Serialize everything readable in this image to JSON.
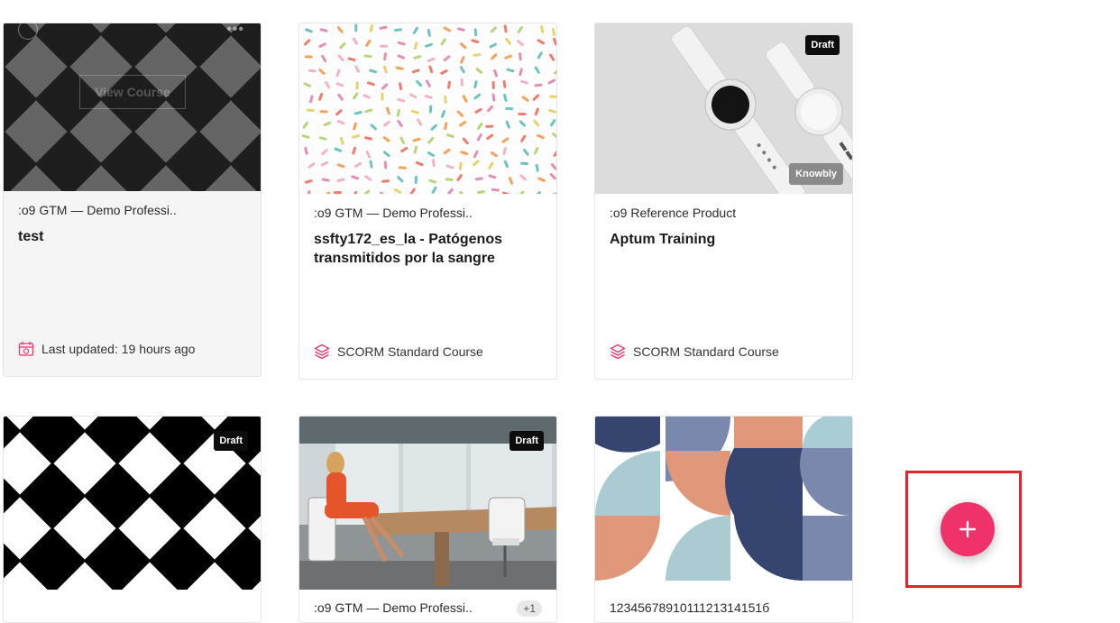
{
  "cards": [
    {
      "org": ":o9 GTM — Demo Professi..",
      "title": "test",
      "meta": "Last updated: 19 hours ago",
      "view_label": "View Course"
    },
    {
      "org": ":o9 GTM — Demo Professi..",
      "title": "ssfty172_es_la - Patógenos transmitidos por la sangre",
      "meta": "SCORM Standard Course"
    },
    {
      "org": ":o9 Reference Product",
      "title": "Aptum Training",
      "meta": "SCORM Standard Course",
      "badge": "Draft",
      "provider": "Knowbly"
    },
    {
      "badge": "Draft"
    },
    {
      "org": ":o9 GTM — Demo Professi..",
      "badge": "Draft",
      "count": "+1"
    },
    {
      "org": "1234567891011121314151б"
    }
  ],
  "fab": {
    "icon": "plus-icon"
  },
  "colors": {
    "accent": "#f0326a",
    "highlight": "#e0262c"
  }
}
